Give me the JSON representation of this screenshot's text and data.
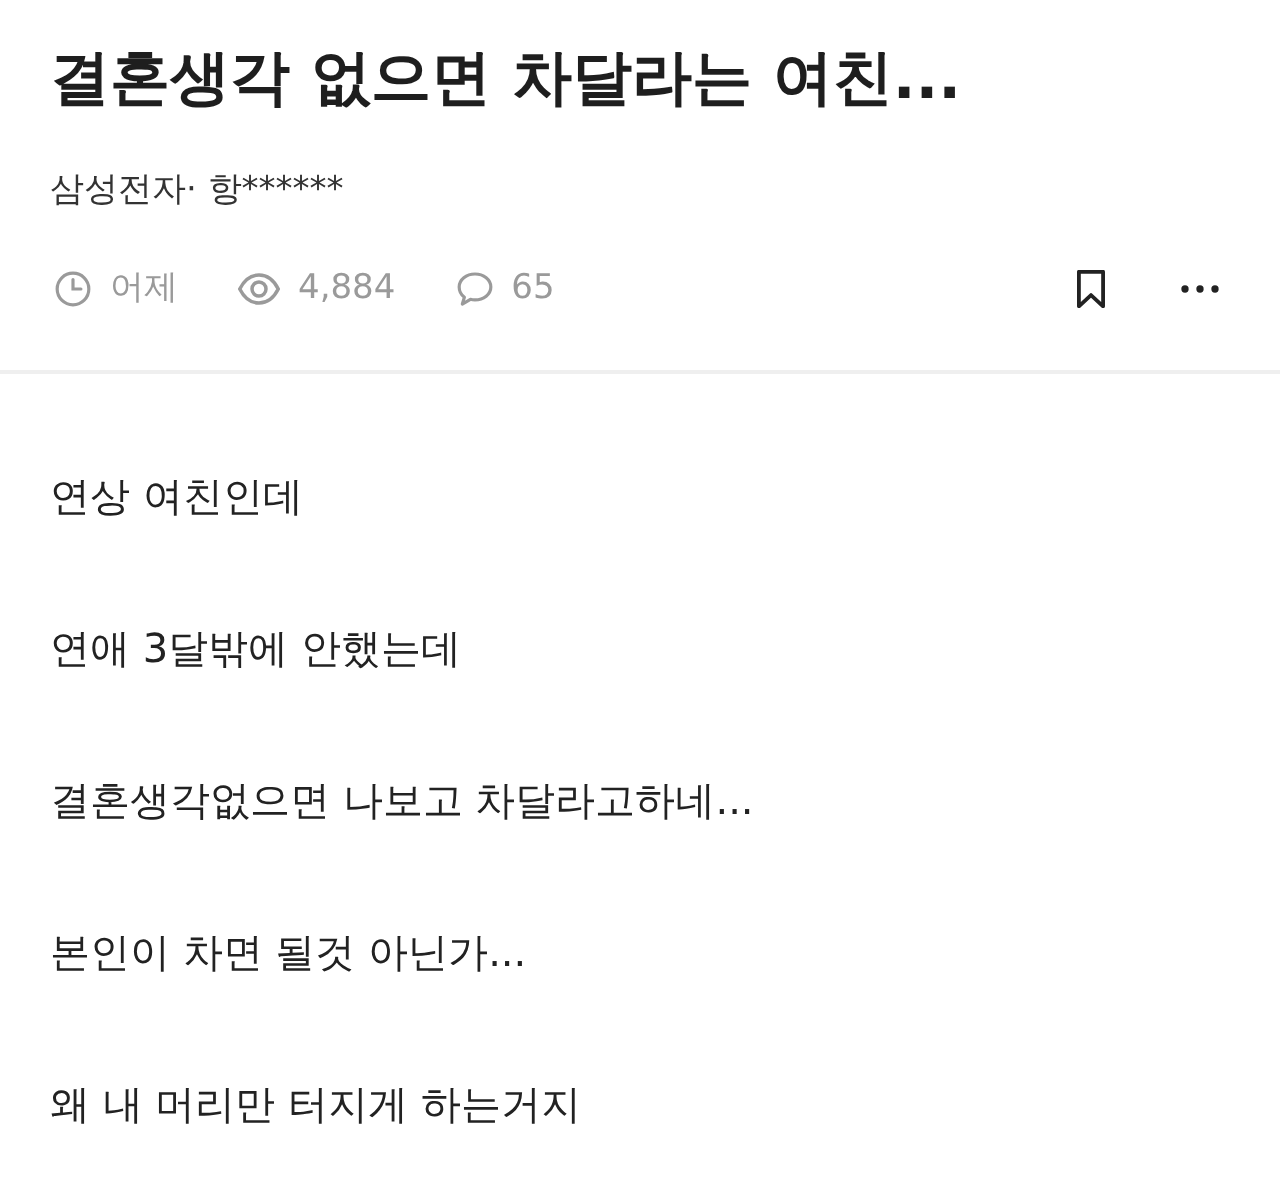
{
  "post": {
    "title": "결혼생각 없으면 차달라는 여친...",
    "author": "삼성전자· 항******",
    "meta": [
      {
        "kind": "time",
        "text": "어제"
      },
      {
        "kind": "views",
        "text": "4,884"
      },
      {
        "kind": "comments",
        "text": "65"
      }
    ],
    "actions": [
      {
        "kind": "bookmark"
      },
      {
        "kind": "more"
      }
    ]
  },
  "body": [
    "연상 여친인데",
    "연애 3달밖에 안했는데",
    "결혼생각없으면 나보고 차달라고하네...",
    "본인이 차면 될것 아닌가...",
    "왜 내 머리만 터지게 하는거지"
  ]
}
